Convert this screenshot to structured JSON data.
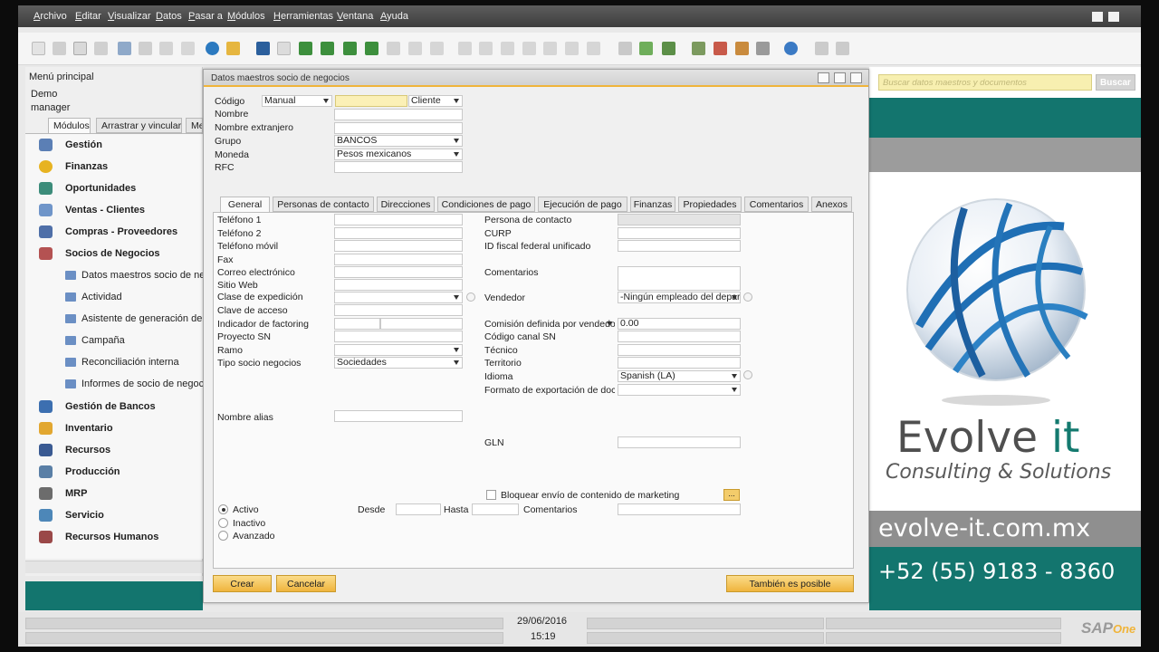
{
  "menubar": [
    "Archivo",
    "Editar",
    "Visualizar",
    "Datos",
    "Pasar a",
    "Módulos",
    "Herramientas",
    "Ventana",
    "Ayuda"
  ],
  "left_panel": {
    "title": "Menú principal",
    "user_line1": "Demo",
    "user_line2": "manager",
    "tabs": [
      "Módulos",
      "Arrastrar y vincular",
      "Me"
    ],
    "modules": [
      {
        "label": "Gestión",
        "color": "#5b7fb5"
      },
      {
        "label": "Finanzas",
        "color": "#e7b321"
      },
      {
        "label": "Oportunidades",
        "color": "#3c8c7a"
      },
      {
        "label": "Ventas - Clientes",
        "color": "#6f95c9"
      },
      {
        "label": "Compras - Proveedores",
        "color": "#4f6fa8"
      },
      {
        "label": "Socios de Negocios",
        "color": "#b45252"
      }
    ],
    "sub_items": [
      "Datos maestros socio de negocios",
      "Actividad",
      "Asistente de generación de",
      "Campaña",
      "Reconciliación interna",
      "Informes de socio de negocios"
    ],
    "modules2": [
      {
        "label": "Gestión de Bancos",
        "color": "#3c6fb0"
      },
      {
        "label": "Inventario",
        "color": "#e2a730"
      },
      {
        "label": "Recursos",
        "color": "#3a5a92"
      },
      {
        "label": "Producción",
        "color": "#5a7fa6"
      },
      {
        "label": "MRP",
        "color": "#6c6c6c"
      },
      {
        "label": "Servicio",
        "color": "#4d87b8"
      },
      {
        "label": "Recursos Humanos",
        "color": "#9a4848"
      }
    ]
  },
  "form": {
    "title": "Datos maestros socio de negocios",
    "header": {
      "codigo_label": "Código",
      "codigo_mode": "Manual",
      "codigo_value": "",
      "codigo_type": "Cliente",
      "nombre_label": "Nombre",
      "nombre_extranjero_label": "Nombre extranjero",
      "grupo_label": "Grupo",
      "grupo_value": "BANCOS",
      "moneda_label": "Moneda",
      "moneda_value": "Pesos mexicanos",
      "rfc_label": "RFC"
    },
    "tabs": [
      "General",
      "Personas de contacto",
      "Direcciones",
      "Condiciones de pago",
      "Ejecución de pago",
      "Finanzas",
      "Propiedades",
      "Comentarios",
      "Anexos"
    ],
    "left_fields": [
      {
        "label": "Teléfono 1",
        "value": ""
      },
      {
        "label": "Teléfono 2",
        "value": ""
      },
      {
        "label": "Teléfono móvil",
        "value": ""
      },
      {
        "label": "Fax",
        "value": ""
      },
      {
        "label": "Correo electrónico",
        "value": ""
      },
      {
        "label": "Sitio Web",
        "value": ""
      },
      {
        "label": "Clase de expedición",
        "value": ""
      },
      {
        "label": "Clave de acceso",
        "value": ""
      },
      {
        "label": "Indicador de factoring",
        "value": ""
      },
      {
        "label": "Proyecto SN",
        "value": ""
      },
      {
        "label": "Ramo",
        "value": ""
      },
      {
        "label": "Tipo socio negocios",
        "value": "Sociedades"
      }
    ],
    "nombre_alias_label": "Nombre alias",
    "right_fields": {
      "persona_contacto": "Persona de contacto",
      "curp": "CURP",
      "id_fiscal": "ID fiscal federal unificado",
      "comentarios": "Comentarios",
      "vendedor": "Vendedor",
      "vendedor_value": "-Ningún empleado del departamento de ventas-",
      "comision": "Comisión definida por vendedor",
      "comision_value": "0.00",
      "codigo_canal": "Código canal SN",
      "tecnico": "Técnico",
      "territorio": "Territorio",
      "idioma": "Idioma",
      "idioma_value": "Spanish (LA)",
      "formato_export": "Formato de exportación de documentos",
      "gln": "GLN"
    },
    "marketing_label": "Bloquear envío de contenido de marketing",
    "dots": "...",
    "status": {
      "activo": "Activo",
      "inactivo": "Inactivo",
      "avanzado": "Avanzado",
      "selected": "Activo",
      "desde": "Desde",
      "hasta": "Hasta",
      "comentarios": "Comentarios"
    },
    "buttons": {
      "crear": "Crear",
      "cancelar": "Cancelar",
      "tambien": "También es posible"
    }
  },
  "search": {
    "placeholder": "Buscar datos maestros y documentos",
    "button": "Buscar"
  },
  "banner": {
    "brand_main": "Evolve ",
    "brand_it": "it",
    "brand_sub": "Consulting & Solutions",
    "url": "evolve-it.com.mx",
    "phone": "+52 (55) 9183 - 8360"
  },
  "statusbar": {
    "date": "29/06/2016",
    "time": "15:19",
    "logo_sap": "SAP",
    "logo_one": "One"
  },
  "colors": {
    "accent": "#f0b43a",
    "teal": "#13756e"
  }
}
